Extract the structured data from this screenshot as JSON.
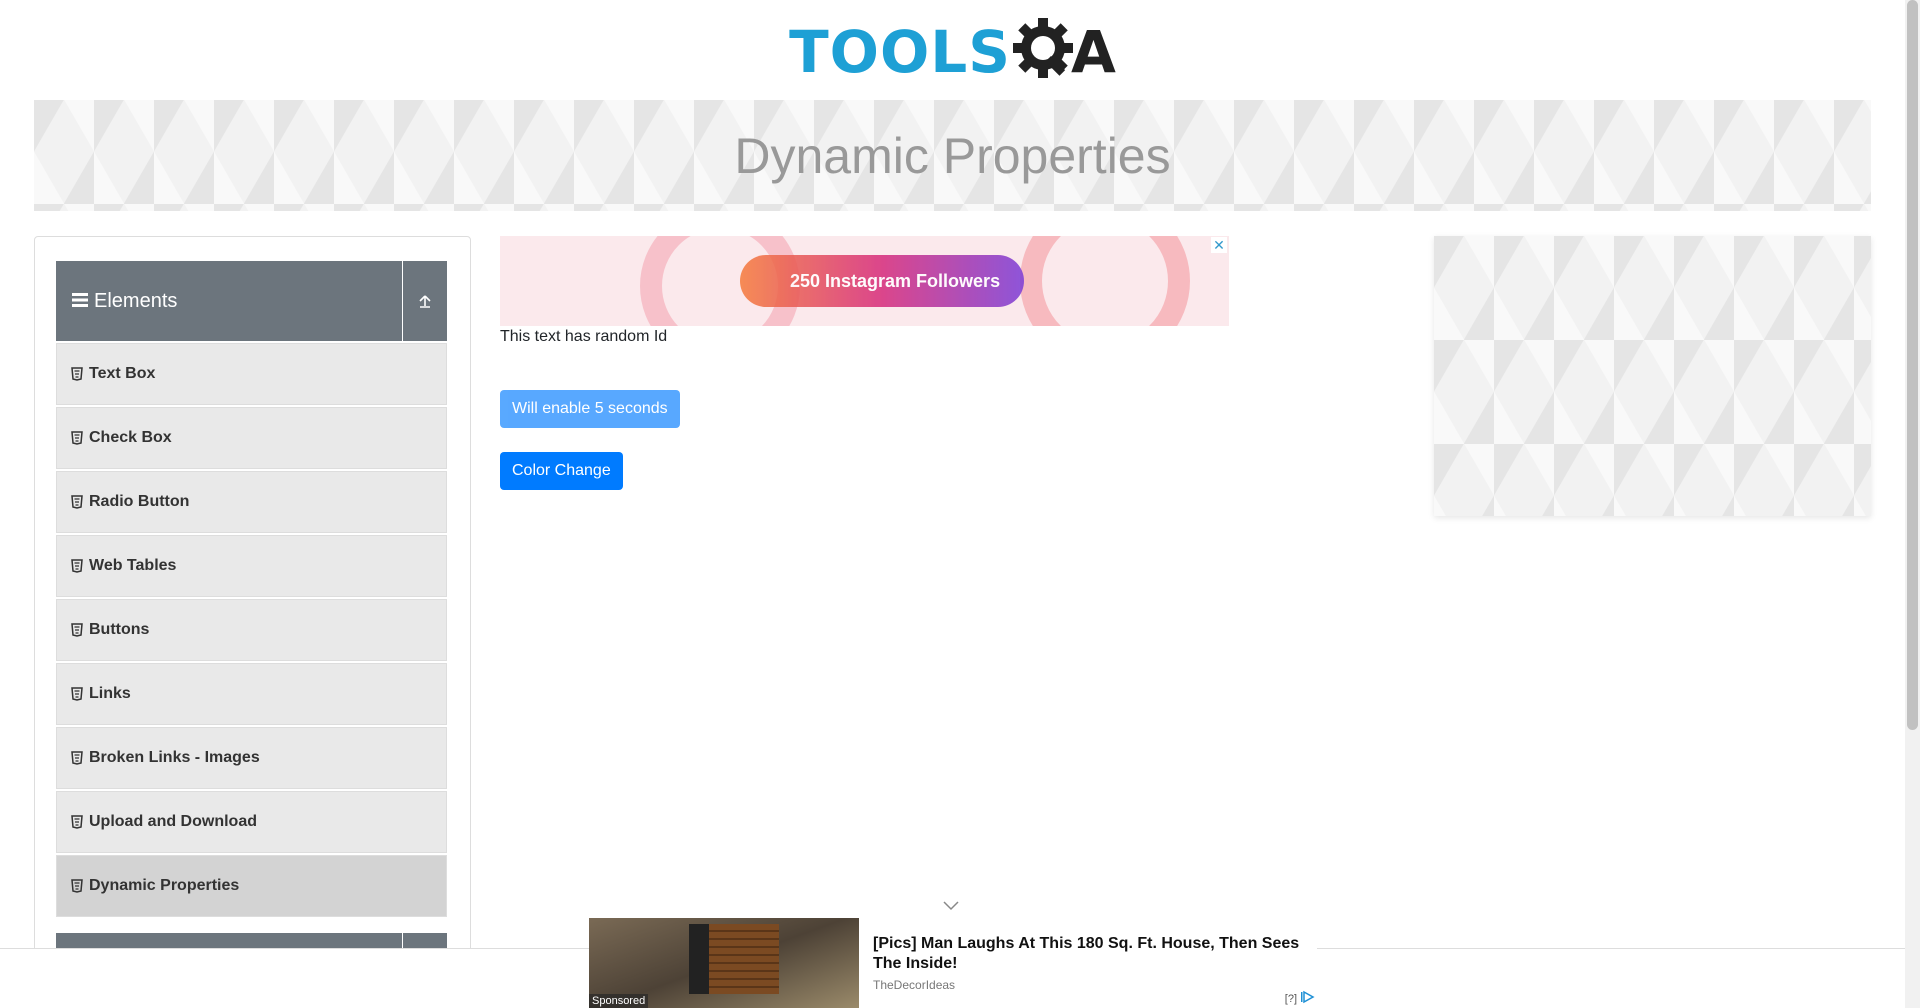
{
  "header": {
    "logo_text": "TOOLS",
    "logo_suffix": "A"
  },
  "banner": {
    "title": "Dynamic Properties"
  },
  "sidebar": {
    "group_title": "Elements",
    "items": [
      {
        "label": "Text Box"
      },
      {
        "label": "Check Box"
      },
      {
        "label": "Radio Button"
      },
      {
        "label": "Web Tables"
      },
      {
        "label": "Buttons"
      },
      {
        "label": "Links"
      },
      {
        "label": "Broken Links - Images"
      },
      {
        "label": "Upload and Download"
      },
      {
        "label": "Dynamic Properties"
      }
    ],
    "active_item": "Dynamic Properties"
  },
  "main": {
    "ad_text": "250 Instagram Followers",
    "random_text": "This text has random Id",
    "enable_button": "Will enable 5 seconds",
    "color_button": "Color Change"
  },
  "sponsored": {
    "headline": "[Pics] Man Laughs At This 180 Sq. Ft. House, Then Sees The Inside!",
    "source": "TheDecorIdeas",
    "label": "Sponsored",
    "adchoice": "[?]"
  },
  "colors": {
    "accent": "#007bff",
    "logo_blue": "#1ea0d5",
    "sidebar_header": "#6c757d",
    "menu_bg": "#e9e9e9"
  }
}
